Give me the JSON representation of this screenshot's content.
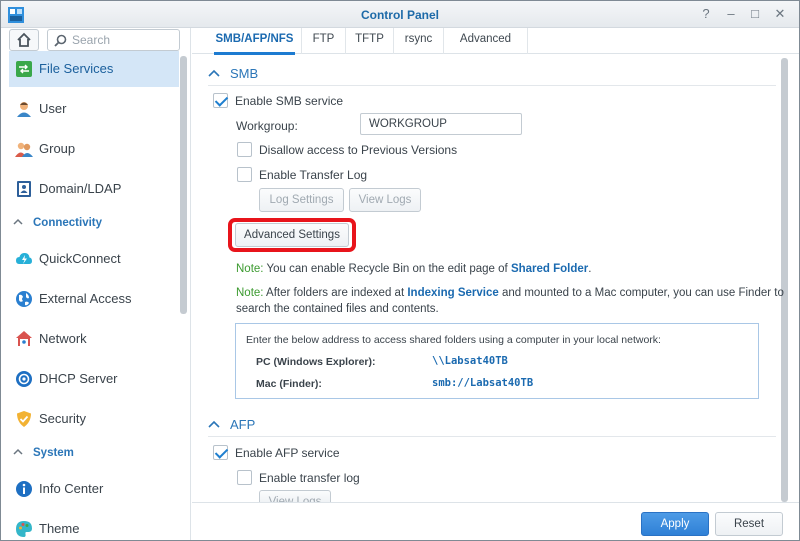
{
  "window": {
    "title": "Control Panel",
    "controls": {
      "help": "?",
      "minimize": "–",
      "maximize": "□",
      "close": "✕"
    }
  },
  "sidebar": {
    "search_placeholder": "Search",
    "items": [
      {
        "label": "File Services",
        "icon": "file-services-icon",
        "active": true
      },
      {
        "label": "User",
        "icon": "user-icon"
      },
      {
        "label": "Group",
        "icon": "group-icon"
      },
      {
        "label": "Domain/LDAP",
        "icon": "domain-icon"
      }
    ],
    "sections": [
      {
        "label": "Connectivity",
        "items": [
          {
            "label": "QuickConnect",
            "icon": "quickconnect-icon"
          },
          {
            "label": "External Access",
            "icon": "globe-icon"
          },
          {
            "label": "Network",
            "icon": "network-icon"
          },
          {
            "label": "DHCP Server",
            "icon": "dhcp-icon"
          },
          {
            "label": "Security",
            "icon": "shield-icon"
          }
        ]
      },
      {
        "label": "System",
        "items": [
          {
            "label": "Info Center",
            "icon": "info-icon"
          },
          {
            "label": "Theme",
            "icon": "theme-icon"
          }
        ]
      }
    ]
  },
  "tabs": [
    "SMB/AFP/NFS",
    "FTP",
    "TFTP",
    "rsync",
    "Advanced"
  ],
  "smb": {
    "header": "SMB",
    "enable_label": "Enable SMB service",
    "enabled": true,
    "workgroup_label": "Workgroup:",
    "workgroup_value": "WORKGROUP",
    "disallow_label": "Disallow access to Previous Versions",
    "transfer_log_label": "Enable Transfer Log",
    "log_settings": "Log Settings",
    "view_logs": "View Logs",
    "advanced_settings": "Advanced Settings",
    "note1": {
      "prefix": "Note:",
      "text": " You can enable Recycle Bin on the edit page of ",
      "link": "Shared Folder",
      "suffix": "."
    },
    "note2": {
      "prefix": "Note:",
      "text": " After folders are indexed at ",
      "link": "Indexing Service",
      "text2": " and mounted to a Mac computer, you can use Finder to",
      "line2": "search the contained files and contents."
    },
    "access_box": {
      "description": "Enter the below address to access shared folders using a computer in your local network:",
      "pc_label": "PC (Windows Explorer):",
      "pc_value": "\\\\Labsat40TB",
      "mac_label": "Mac (Finder):",
      "mac_value": "smb://Labsat40TB"
    }
  },
  "afp": {
    "header": "AFP",
    "enable_label": "Enable AFP service",
    "enabled": true,
    "transfer_log_label": "Enable transfer log",
    "view_logs": "View Logs"
  },
  "footer": {
    "apply": "Apply",
    "reset": "Reset"
  },
  "colors": {
    "accent": "#1b6ab0",
    "highlight": "#e8141b",
    "note_green": "#3b9a2f"
  }
}
